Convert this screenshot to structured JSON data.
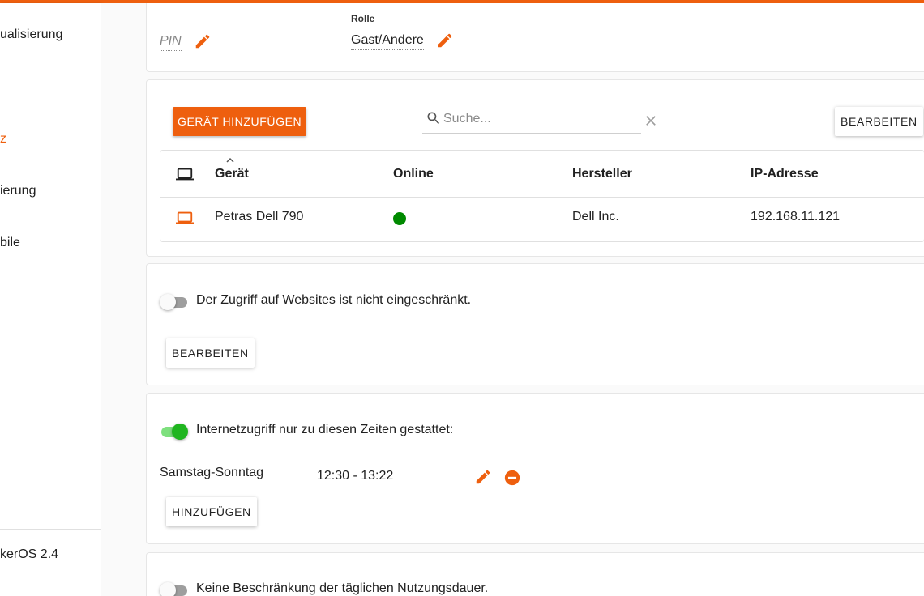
{
  "sidebar": {
    "items": [
      {
        "label": "ualisierung"
      },
      {
        "label": "z"
      },
      {
        "label": "ierung"
      },
      {
        "label": "bile"
      },
      {
        "label": "kerOS 2.4"
      }
    ]
  },
  "profile": {
    "pin_placeholder": "PIN",
    "role_label": "Rolle",
    "role_value": "Gast/Andere"
  },
  "devices": {
    "add_button": "GERÄT HINZUFÜGEN",
    "search_placeholder": "Suche...",
    "edit_button": "BEARBEITEN",
    "columns": {
      "device": "Gerät",
      "online": "Online",
      "manufacturer": "Hersteller",
      "ip": "IP-Adresse"
    },
    "rows": [
      {
        "device": "Petras Dell 790",
        "online": true,
        "manufacturer": "Dell Inc.",
        "ip": "192.168.11.121"
      }
    ]
  },
  "websites": {
    "toggle_on": false,
    "text": "Der Zugriff auf Websites ist nicht eingeschränkt.",
    "edit_button": "BEARBEITEN"
  },
  "schedule": {
    "toggle_on": true,
    "text": "Internetzugriff nur zu diesen Zeiten gestattet:",
    "entries": [
      {
        "days": "Samstag-Sonntag",
        "time": "12:30 - 13:22"
      }
    ],
    "add_button": "HINZUFÜGEN"
  },
  "usage": {
    "toggle_on": false,
    "text": "Keine Beschränkung der täglichen Nutzungsdauer."
  },
  "colors": {
    "accent": "#ee5f0e",
    "online": "#008a00",
    "toggle_on": "#1fb51f"
  }
}
